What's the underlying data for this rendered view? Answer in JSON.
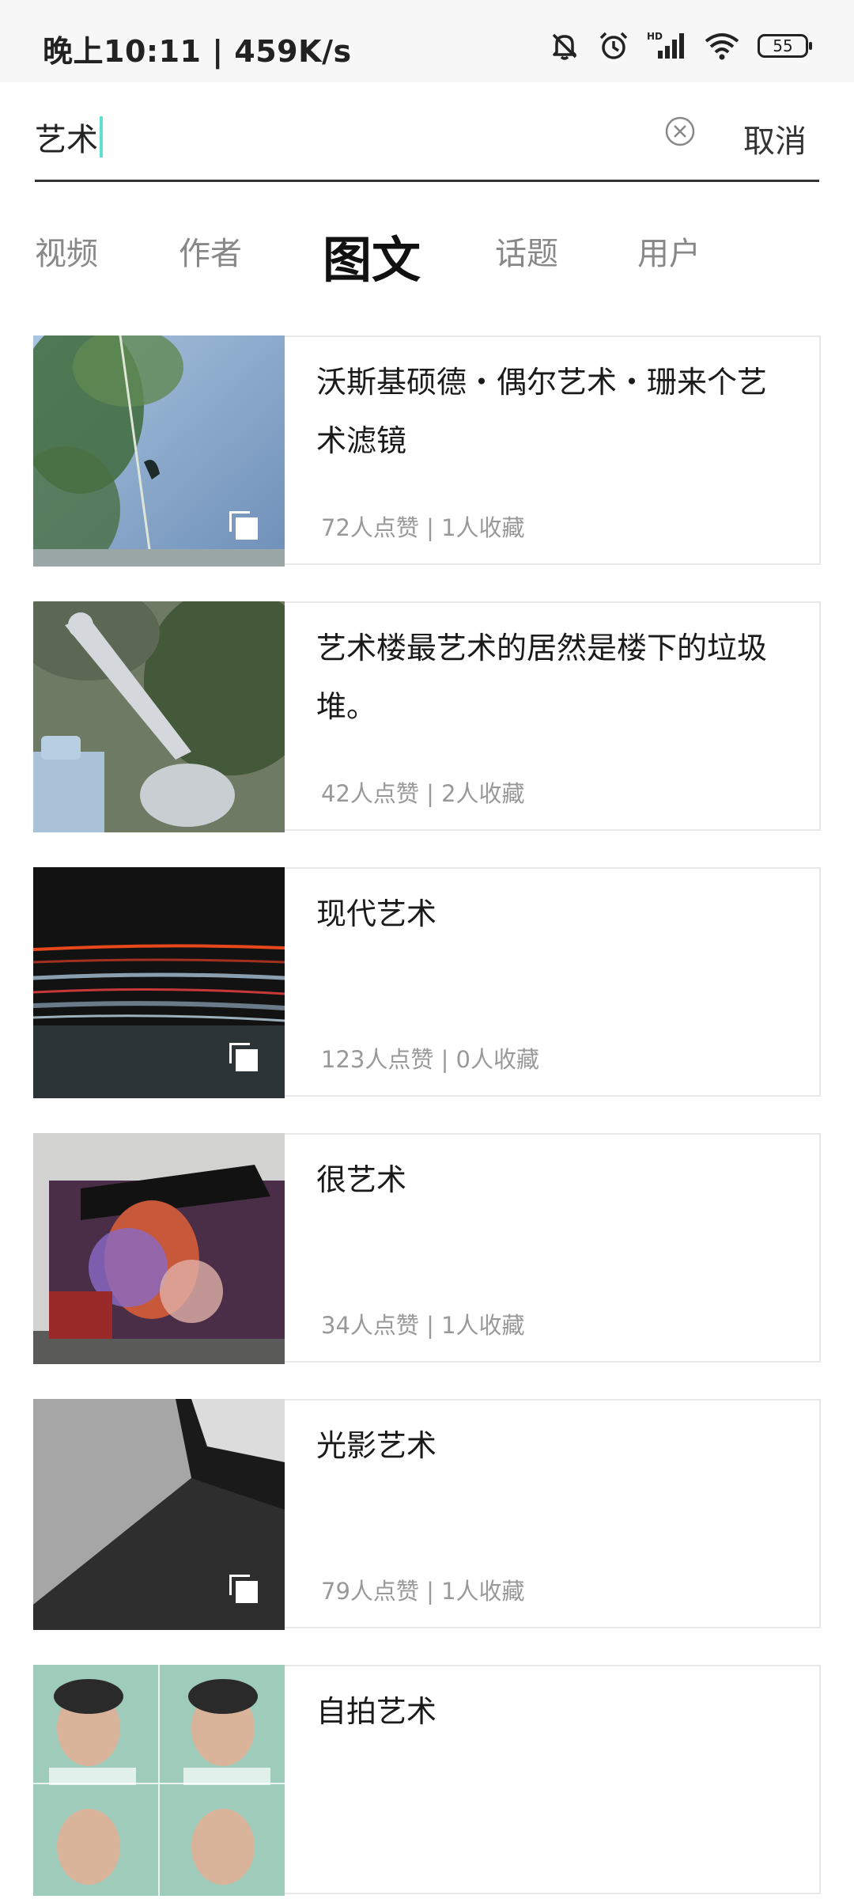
{
  "status_bar": {
    "time_speed": "晚上10:11 | 459K/s",
    "battery_level": "55",
    "icons": [
      "bell-off-icon",
      "alarm-icon",
      "hd-signal-icon",
      "wifi-icon",
      "battery-icon"
    ]
  },
  "search": {
    "value": "艺术",
    "cancel_label": "取消",
    "clear_icon": "clear-circle-icon"
  },
  "tabs": [
    {
      "label": "视频",
      "active": false
    },
    {
      "label": "作者",
      "active": false
    },
    {
      "label": "图文",
      "active": true
    },
    {
      "label": "话题",
      "active": false
    },
    {
      "label": "用户",
      "active": false
    }
  ],
  "results": [
    {
      "title": "沃斯基硕德・偶尔艺术・珊来个艺术滤镜",
      "meta": "72人点赞 | 1人收藏",
      "multi_image": true,
      "thumb_colors": [
        "#7aa0c8",
        "#3b6a3a"
      ]
    },
    {
      "title": "艺术楼最艺术的居然是楼下的垃圾堆。",
      "meta": "42人点赞 | 2人收藏",
      "multi_image": false,
      "thumb_colors": [
        "#8a8f88",
        "#4a5a40"
      ]
    },
    {
      "title": "现代艺术",
      "meta": "123人点赞 | 0人收藏",
      "multi_image": true,
      "thumb_colors": [
        "#141414",
        "#d83a1a"
      ]
    },
    {
      "title": "很艺术",
      "meta": "34人点赞 | 1人收藏",
      "multi_image": false,
      "thumb_colors": [
        "#c8c8c8",
        "#6a3a7a"
      ]
    },
    {
      "title": "光影艺术",
      "meta": "79人点赞 | 1人收藏",
      "multi_image": true,
      "thumb_colors": [
        "#2a2a2a",
        "#bdbdbd"
      ]
    },
    {
      "title": "自拍艺术",
      "meta": "",
      "multi_image": false,
      "thumb_colors": [
        "#7fb5a4",
        "#c9a08a"
      ]
    }
  ]
}
